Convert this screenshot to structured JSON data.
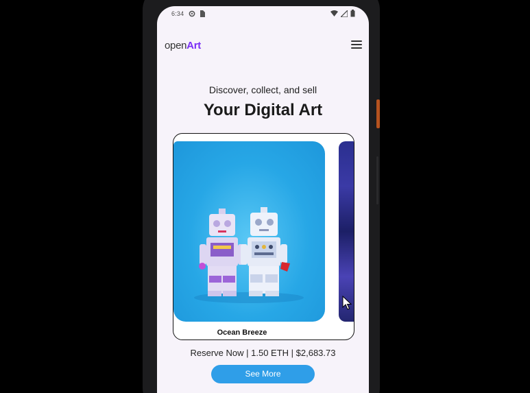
{
  "status_bar": {
    "time": "6:34"
  },
  "header": {
    "logo_open": "open",
    "logo_art": "Art"
  },
  "hero": {
    "tagline": "Discover, collect, and sell",
    "headline": "Your Digital Art"
  },
  "carousel": {
    "items": [
      {
        "title": "Ocean Breeze"
      }
    ]
  },
  "listing": {
    "price_line": "Reserve Now | 1.50 ETH | $2,683.73"
  },
  "actions": {
    "see_more_label": "See More"
  },
  "colors": {
    "accent": "#7b2ff7",
    "button": "#2f9ee8",
    "screen_bg": "#f7f3fa"
  },
  "icons": [
    "settings-status-icon",
    "sim-status-icon",
    "wifi-icon",
    "signal-icon",
    "battery-icon",
    "hamburger-menu-icon",
    "cursor-arrow-icon"
  ]
}
